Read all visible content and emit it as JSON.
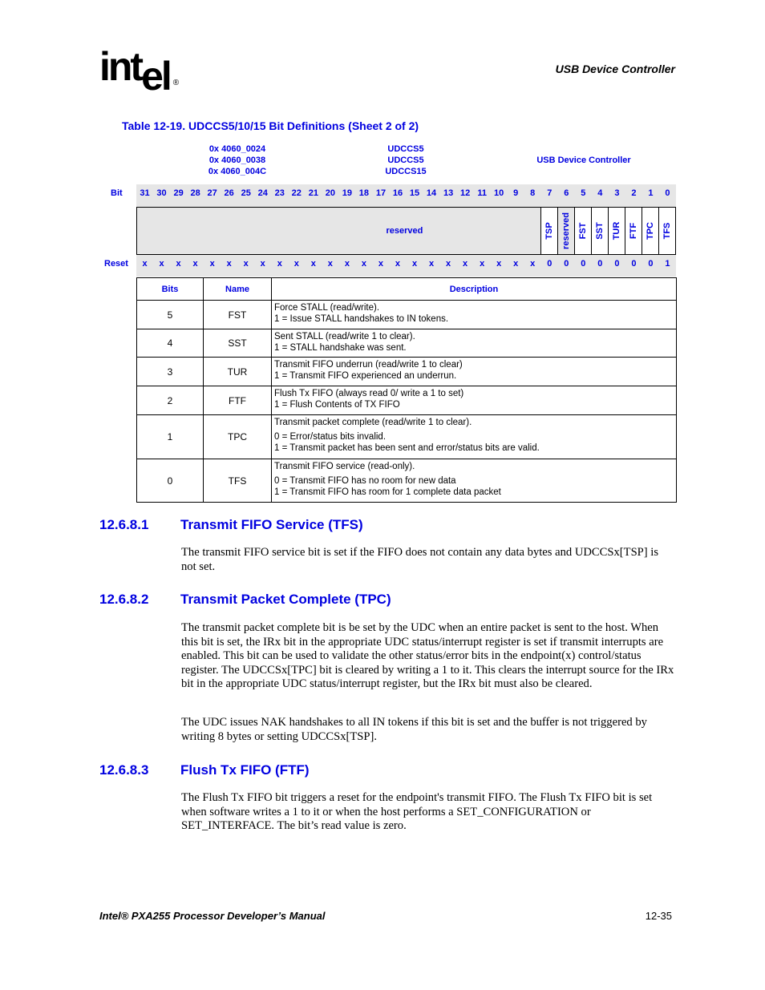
{
  "header": {
    "logo": {
      "text_a": "int",
      "text_b": "el",
      "registered": "®"
    },
    "section": "USB Device Controller"
  },
  "table": {
    "title": "Table 12-19. UDCCS5/10/15 Bit Definitions (Sheet 2 of 2)",
    "addresses": [
      "0x 4060_0024",
      "0x 4060_0038",
      "0x 4060_004C"
    ],
    "register_names": [
      "UDCCS5",
      "UDCCS5",
      "UDCCS15"
    ],
    "unit": "USB Device Controller",
    "bit_label": "Bit",
    "reset_label": "Reset",
    "bit_numbers": [
      "31",
      "30",
      "29",
      "28",
      "27",
      "26",
      "25",
      "24",
      "23",
      "22",
      "21",
      "20",
      "19",
      "18",
      "17",
      "16",
      "15",
      "14",
      "13",
      "12",
      "11",
      "10",
      "9",
      "8",
      "7",
      "6",
      "5",
      "4",
      "3",
      "2",
      "1",
      "0"
    ],
    "reset_values": [
      "x",
      "x",
      "x",
      "x",
      "x",
      "x",
      "x",
      "x",
      "x",
      "x",
      "x",
      "x",
      "x",
      "x",
      "x",
      "x",
      "x",
      "x",
      "x",
      "x",
      "x",
      "x",
      "x",
      "x",
      "0",
      "0",
      "0",
      "0",
      "0",
      "0",
      "0",
      "1"
    ],
    "reserved_wide_label": "reserved",
    "fields": [
      {
        "bit": "7",
        "name": "TSP"
      },
      {
        "bit": "6",
        "name": "reserved"
      },
      {
        "bit": "5",
        "name": "FST"
      },
      {
        "bit": "4",
        "name": "SST"
      },
      {
        "bit": "3",
        "name": "TUR"
      },
      {
        "bit": "2",
        "name": "FTF"
      },
      {
        "bit": "1",
        "name": "TPC"
      },
      {
        "bit": "0",
        "name": "TFS"
      }
    ],
    "columns": {
      "bits": "Bits",
      "name": "Name",
      "description": "Description"
    },
    "rows": [
      {
        "bits": "5",
        "name": "FST",
        "desc": [
          "Force STALL (read/write).",
          "1 =  Issue STALL handshakes to IN tokens."
        ]
      },
      {
        "bits": "4",
        "name": "SST",
        "desc": [
          "Sent STALL (read/write 1 to clear).",
          "1 =  STALL handshake was sent."
        ]
      },
      {
        "bits": "3",
        "name": "TUR",
        "desc": [
          "Transmit FIFO underrun (read/write 1 to clear)",
          "1 =  Transmit FIFO experienced an underrun."
        ]
      },
      {
        "bits": "2",
        "name": "FTF",
        "desc": [
          "Flush Tx FIFO (always read 0/ write a 1 to set)",
          "1 =  Flush Contents of TX FIFO"
        ]
      },
      {
        "bits": "1",
        "name": "TPC",
        "desc": [
          "Transmit packet complete (read/write 1 to clear).",
          "0 =  Error/status bits invalid.",
          "1 =  Transmit packet has been sent and error/status bits are valid."
        ]
      },
      {
        "bits": "0",
        "name": "TFS",
        "desc": [
          "Transmit FIFO service (read-only).",
          "0 =  Transmit FIFO has no room for new data",
          "1 =  Transmit FIFO has room for 1 complete data packet"
        ]
      }
    ]
  },
  "sections": [
    {
      "number": "12.6.8.1",
      "title": "Transmit FIFO Service (TFS)",
      "paragraphs": [
        "The transmit FIFO service bit is set if the FIFO does not contain any data bytes and UDCCSx[TSP] is not set."
      ]
    },
    {
      "number": "12.6.8.2",
      "title": "Transmit Packet Complete (TPC)",
      "paragraphs": [
        "The transmit packet complete bit is be set by the UDC when an entire packet is sent to the host. When this bit is set, the IRx bit in the appropriate UDC status/interrupt register is set if transmit interrupts are enabled. This bit can be used to validate the other status/error bits in the endpoint(x) control/status register. The UDCCSx[TPC] bit is cleared by writing a 1 to it. This clears the interrupt source for the IRx bit in the appropriate UDC status/interrupt register, but the IRx bit must also be cleared.",
        "The UDC issues NAK handshakes to all IN tokens if this bit is set and the buffer is not triggered by writing 8 bytes or setting UDCCSx[TSP]."
      ]
    },
    {
      "number": "12.6.8.3",
      "title": "Flush Tx FIFO (FTF)",
      "paragraphs": [
        "The Flush Tx FIFO bit triggers a reset for the endpoint's transmit FIFO. The Flush Tx FIFO bit is set when software writes a 1 to it or when the host performs a SET_CONFIGURATION or SET_INTERFACE. The bit’s read value is zero."
      ]
    }
  ],
  "footer": {
    "manual": "Intel® PXA255 Processor Developer’s Manual",
    "page": "12-35"
  }
}
